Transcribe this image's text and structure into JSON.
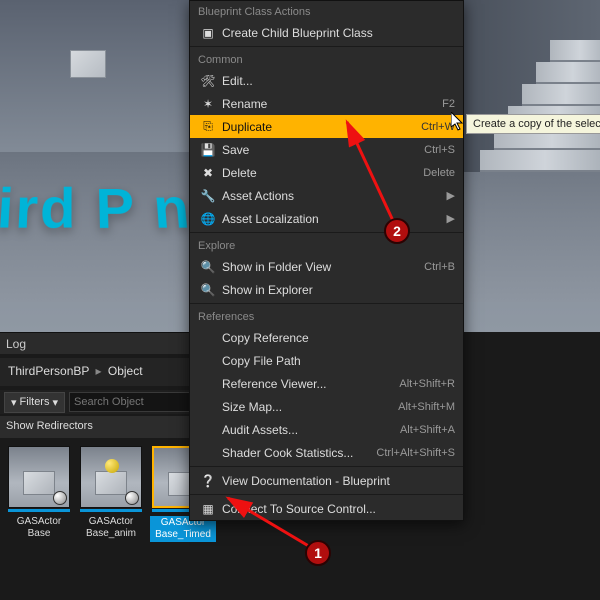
{
  "viewport_text": "hird P            n",
  "log_label": "Log",
  "breadcrumb": {
    "a": "ThirdPersonBP",
    "b": "Object"
  },
  "filters_label": "Filters",
  "search_placeholder": "Search Object",
  "redirectors_label": "Show Redirectors",
  "assets": [
    {
      "name": "GASActor\nBase"
    },
    {
      "name": "GASActor\nBase_anim"
    },
    {
      "name": "GASActor\nBase_Timed"
    }
  ],
  "menu": {
    "sec_bp": "Blueprint Class Actions",
    "create_child": "Create Child Blueprint Class",
    "sec_common": "Common",
    "edit": "Edit...",
    "rename": "Rename",
    "rename_sc": "F2",
    "duplicate": "Duplicate",
    "duplicate_sc": "Ctrl+W",
    "save": "Save",
    "save_sc": "Ctrl+S",
    "delete": "Delete",
    "delete_sc": "Delete",
    "asset_actions": "Asset Actions",
    "asset_local": "Asset Localization",
    "sec_explore": "Explore",
    "folder_view": "Show in Folder View",
    "folder_sc": "Ctrl+B",
    "explorer": "Show in Explorer",
    "sec_refs": "References",
    "copy_ref": "Copy Reference",
    "copy_path": "Copy File Path",
    "ref_viewer": "Reference Viewer...",
    "ref_sc": "Alt+Shift+R",
    "size_map": "Size Map...",
    "size_sc": "Alt+Shift+M",
    "audit": "Audit Assets...",
    "audit_sc": "Alt+Shift+A",
    "shader": "Shader Cook Statistics...",
    "shader_sc": "Ctrl+Alt+Shift+S",
    "docs": "View Documentation - Blueprint",
    "source_ctrl": "Connect To Source Control..."
  },
  "tooltip": "Create a copy of the select",
  "annot": {
    "one": "1",
    "two": "2"
  }
}
